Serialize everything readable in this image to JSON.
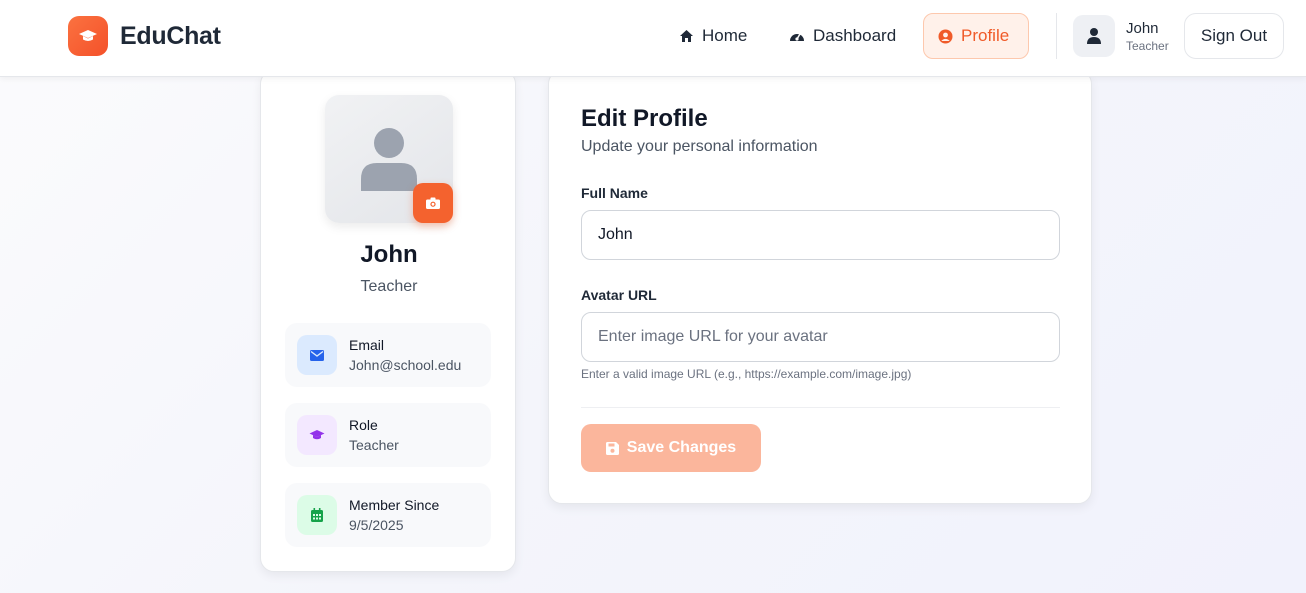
{
  "app": {
    "name": "EduChat"
  },
  "nav": {
    "home": "Home",
    "dashboard": "Dashboard",
    "profile": "Profile"
  },
  "user": {
    "name": "John",
    "role": "Teacher"
  },
  "header": {
    "sign_out": "Sign Out"
  },
  "profile_card": {
    "name": "John",
    "role": "Teacher",
    "info": [
      {
        "label": "Email",
        "value": "John@school.edu",
        "icon": "mail-icon"
      },
      {
        "label": "Role",
        "value": "Teacher",
        "icon": "graduation-cap-icon"
      },
      {
        "label": "Member Since",
        "value": "9/5/2025",
        "icon": "calendar-icon"
      }
    ]
  },
  "edit": {
    "title": "Edit Profile",
    "subtitle": "Update your personal information",
    "full_name_label": "Full Name",
    "full_name_value": "John",
    "avatar_label": "Avatar URL",
    "avatar_placeholder": "Enter image URL for your avatar",
    "avatar_hint": "Enter a valid image URL (e.g., https://example.com/image.jpg)",
    "save_label": "Save Changes"
  },
  "colors": {
    "accent": "#f4622e",
    "accent_light": "#fff1ea",
    "save_disabled": "#fbb69c"
  }
}
